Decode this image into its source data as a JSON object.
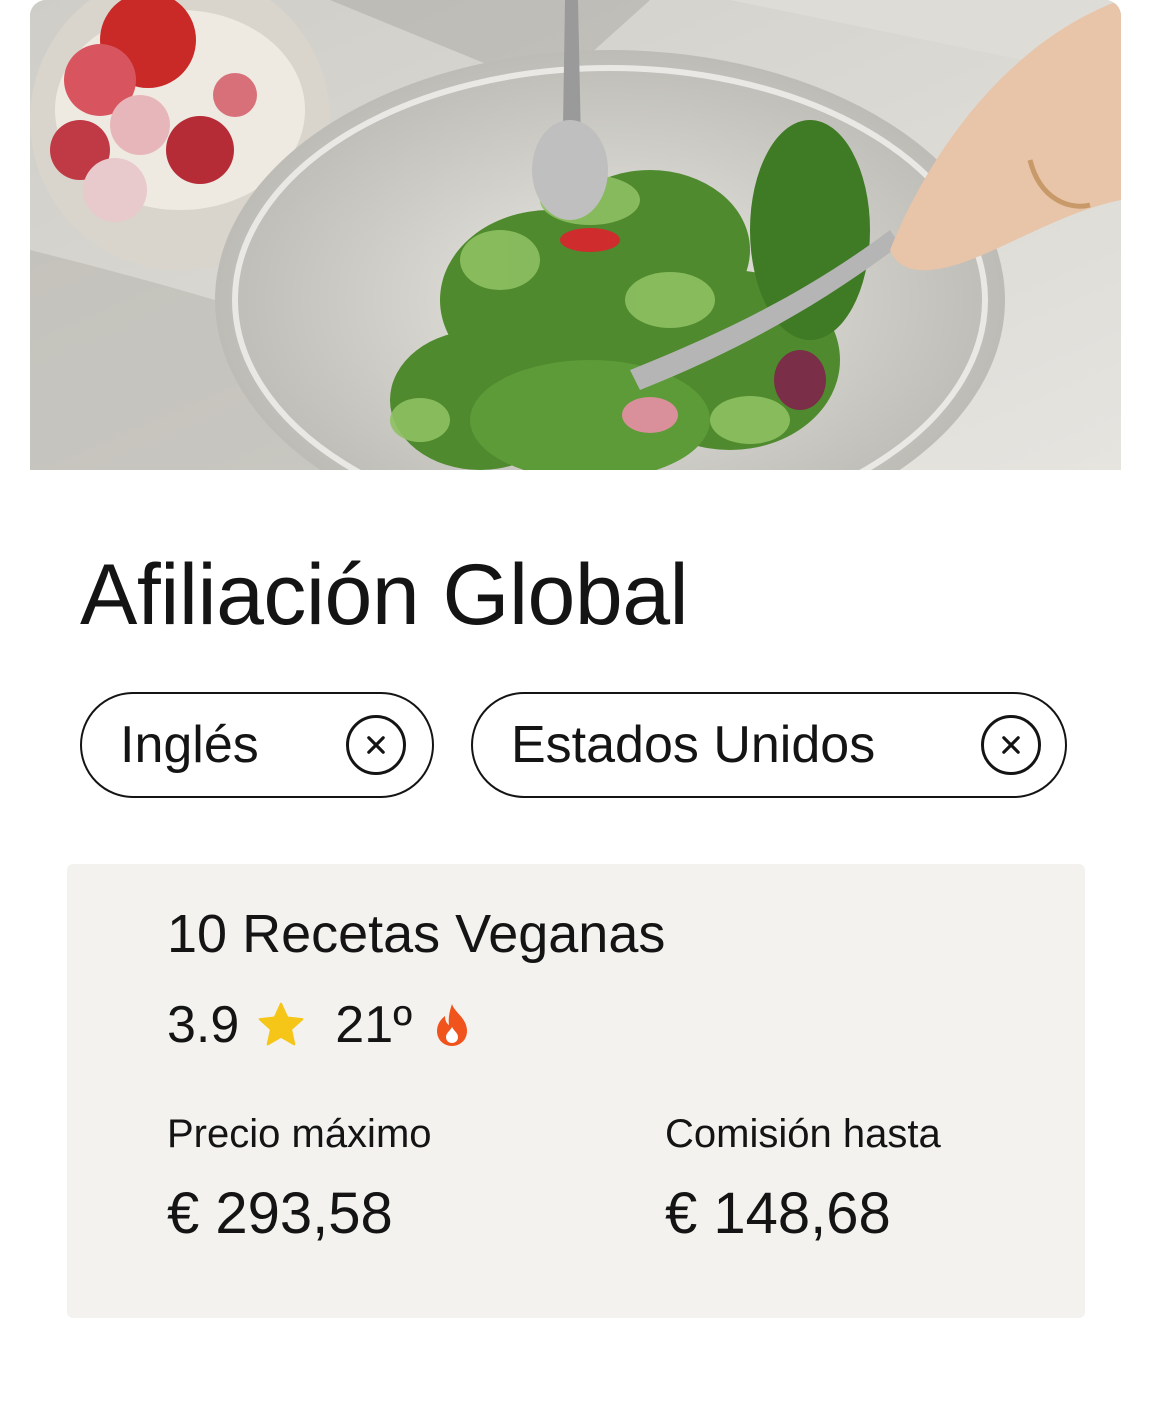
{
  "offer": {
    "title": "Afiliación Global"
  },
  "filters": [
    {
      "label": "Inglés"
    },
    {
      "label": "Estados Unidos"
    }
  ],
  "product": {
    "name": "10 Recetas Veganas",
    "rating": "3.9",
    "rank": "21º",
    "max_price_label": "Precio máximo",
    "max_price_value": "€ 293,58",
    "commission_label": "Comisión hasta",
    "commission_value": "€ 148,68"
  },
  "icons": {
    "rating": "star-icon",
    "rank": "fire-icon",
    "chip_remove": "close-icon"
  },
  "colors": {
    "star": "#f5c518",
    "fire": "#f0531c",
    "card_background": "#f3f2ef",
    "text": "#141414"
  }
}
